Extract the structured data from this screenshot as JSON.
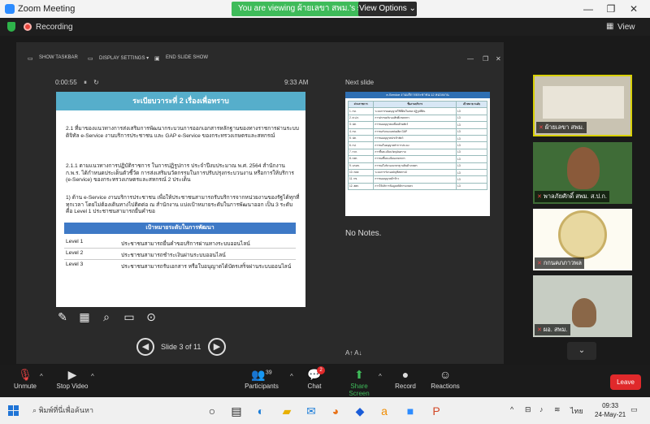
{
  "window": {
    "title": "Zoom Meeting",
    "viewing_banner": "You are viewing ผ้ายเลขา สพม.'s screen",
    "view_options": "View Options ⌄",
    "view_button": "View"
  },
  "recording": {
    "label": "Recording"
  },
  "share_toolbar": {
    "show_taskbar": "SHOW TASKBAR",
    "display_settings": "DISPLAY SETTINGS ▾",
    "end_slide_show": "END SLIDE SHOW"
  },
  "presenter": {
    "timer": "0:00:55",
    "clock": "9:33 AM",
    "next_slide_label": "Next slide",
    "notes": "No Notes.",
    "slide_counter": "Slide 3 of 11"
  },
  "slide": {
    "title": "ระเบียบวาระที่ 2 เรื่องเพื่อทราบ",
    "p1": "2.1 ที่มาของแนวทางการส่งเสริมการพัฒนากระบวนการออกเอกสารหลักฐานของทางราชการผ่านระบบดิจิทัล e-Service งานบริการประชาชน และ GAP e-Service ของกระทรวงเกษตรและสหกรณ์",
    "p2": "2.1.1 ตามแนวทางการปฏิบัติราชการ ในการปฏิรูปการ ประจำปีงบประมาณ พ.ศ. 2564 สำนักงาน ก.พ.ร. ได้กำหนดประเด็นตัวชี้วัด การส่งเสริมนวัตกรรมในการปรับปรุงกระบวนงาน หรือการให้บริการ (e-Service) ของกระทรวงเกษตรและสหกรณ์ 2 ประเด็น",
    "p3": "1) ด้าน e-Service งานบริการประชาชน เพื่อให้ประชาชนสามารถรับบริการจากหน่วยงานของรัฐได้ทุกที่ ทุกเวลา โดยไม่ต้องเดินทางไปติดต่อ ณ สำนักงาน แบ่งเป้าหมายระดับในการพัฒนาออก เป็น 3 ระดับ คือ Level 1 ประชาชนสามารถยื่นคำขอ",
    "table_header": "เป้าหมายระดับในการพัฒนา",
    "levels": [
      {
        "level": "Level 1",
        "desc": "ประชาชนสามารถยื่นคำขอบริการผ่านทางระบบออนไลน์"
      },
      {
        "level": "Level 2",
        "desc": "ประชาชนสามารถชำระเงินผ่านระบบออนไลน์"
      },
      {
        "level": "Level 3",
        "desc": "ประชาชนสามารถรับเอกสาร หรือใบอนุญาตได้บัตรเสร็จผ่านระบบออนไลน์"
      }
    ]
  },
  "next_slide": {
    "header": "e-Service งานบริการประชาชน 12 หน่วยงาน",
    "columns": [
      "ส่วนราชการ",
      "ชื่องานบริการ",
      "เป้าหมาย ระดับ"
    ],
    "rows": [
      [
        "1. กษ.",
        "ระบบการขออนุญาตใช้ที่ดินในเขต ปฏิรูปที่ดิน",
        "L3"
      ],
      [
        "2. ส.ป.ก.",
        "การฝากขอรับรองสิทธิ์เกษตรกร",
        "L3"
      ],
      [
        "3. ปศ.",
        "การขออนุญาตเคลื่อนย้ายสัตว์",
        "L3"
      ],
      [
        "4. กษ.",
        "การขอรับรองแหล่งผลิต GAP",
        "L3"
      ],
      [
        "5. ปศ.",
        "การขออนุญาตนำเข้าสัตว์",
        "L3"
      ],
      [
        "6. กป.",
        "การขอใบอนุญาตทำการประมง",
        "L3"
      ],
      [
        "7. กวก.",
        "การขึ้นทะเบียนวัตถุอันตราย",
        "L3"
      ],
      [
        "8. กสก.",
        "การขอขึ้นทะเบียนเกษตรกร",
        "L3"
      ],
      [
        "9. มกอช.",
        "การขอใบรับรองมาตรฐานสินค้าเกษตร",
        "L3"
      ],
      [
        "10. กตส.",
        "ระบบการรับรองบัญชีสหกรณ์",
        "L3"
      ],
      [
        "11. กข.",
        "การขออนุญาตค้าข้าว",
        "L3"
      ],
      [
        "12. สศก.",
        "การให้บริการข้อมูลสถิติการเกษตร",
        "L3"
      ]
    ]
  },
  "gallery": [
    {
      "name": "ผ้ายเลขา สพม."
    },
    {
      "name": "พาลภัยศักดิ์ สพม. ส.ป.ก."
    },
    {
      "name": "กกนคภภาวพล"
    },
    {
      "name": "ผอ. สพม."
    }
  ],
  "toolbar": {
    "unmute": "Unmute",
    "stop_video": "Stop Video",
    "participants": "Participants",
    "participants_count": "39",
    "chat": "Chat",
    "chat_badge": "2",
    "share_screen": "Share Screen",
    "record": "Record",
    "reactions": "Reactions",
    "leave": "Leave"
  },
  "taskbar": {
    "search_placeholder": "พิมพ์ที่นี่เพื่อค้นหา",
    "lang": "ไทย",
    "time": "09:33",
    "date": "24-May-21"
  }
}
